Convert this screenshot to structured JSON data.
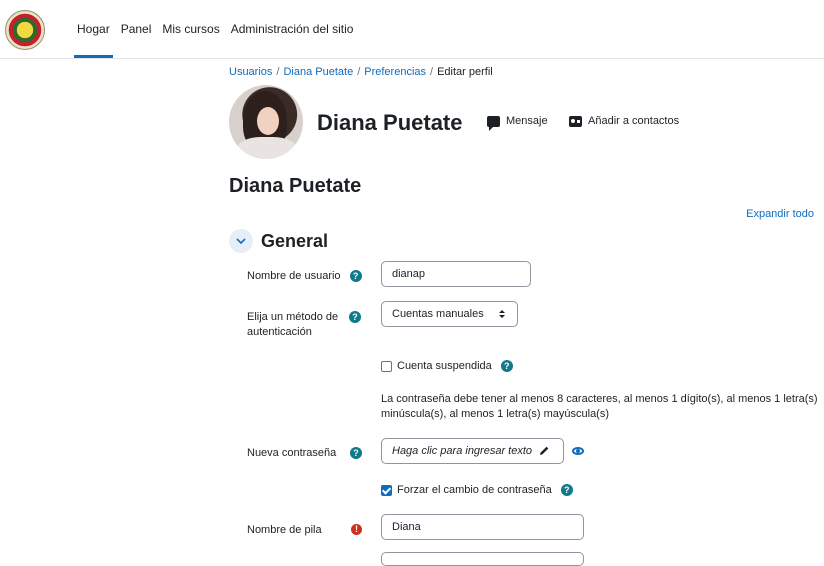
{
  "nav": {
    "items": [
      "Hogar",
      "Panel",
      "Mis cursos",
      "Administración del sitio"
    ]
  },
  "breadcrumb": {
    "items": [
      "Usuarios",
      "Diana Puetate",
      "Preferencias",
      "Editar perfil"
    ]
  },
  "profile": {
    "name": "Diana Puetate",
    "message_label": "Mensaje",
    "add_contact_label": "Añadir a contactos"
  },
  "page": {
    "title": "Diana Puetate",
    "expand_all": "Expandir todo",
    "section_title": "General"
  },
  "form": {
    "username_label": "Nombre de usuario",
    "username_value": "dianap",
    "auth_label": "Elija un método de autenticación",
    "auth_value": "Cuentas manuales",
    "suspended_label": "Cuenta suspendida",
    "password_rules": "La contraseña debe tener al menos 8 caracteres, al menos 1 dígito(s), al menos 1 letra(s) minúscula(s), al menos 1 letra(s) mayúscula(s)",
    "new_password_label": "Nueva contraseña",
    "new_password_placeholder": "Haga clic para ingresar texto",
    "force_change_label": "Forzar el cambio de contraseña",
    "firstname_label": "Nombre de pila",
    "firstname_value": "Diana"
  },
  "colors": {
    "accent": "#0f6cbf",
    "help": "#0f7a8a",
    "required": "#ca3120"
  }
}
